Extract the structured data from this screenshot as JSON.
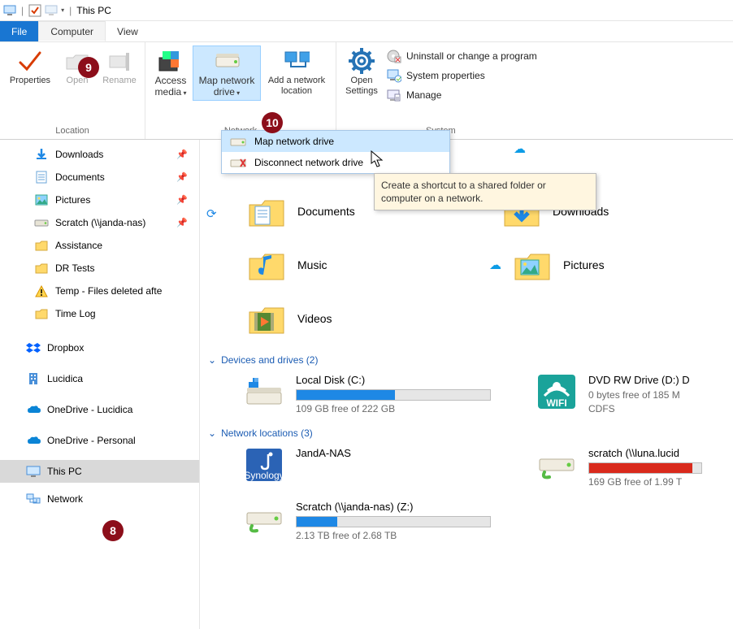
{
  "window": {
    "title": "This PC"
  },
  "tabs": {
    "file": "File",
    "computer": "Computer",
    "view": "View"
  },
  "ribbon": {
    "location_group": "Location",
    "network_group": "Network",
    "system_group": "System",
    "properties": "Properties",
    "open": "Open",
    "rename": "Rename",
    "access_media": "Access media",
    "map_network_drive": "Map network drive",
    "add_network_location": "Add a network location",
    "open_settings": "Open Settings",
    "uninstall": "Uninstall or change a program",
    "system_props": "System properties",
    "manage": "Manage"
  },
  "dropdown": {
    "map": "Map network drive",
    "disconnect": "Disconnect network drive"
  },
  "tooltip": "Create a shortcut to a shared folder or computer on a network.",
  "nav": {
    "items": [
      {
        "label": "Downloads",
        "icon": "download",
        "pinned": true
      },
      {
        "label": "Documents",
        "icon": "doc",
        "pinned": true
      },
      {
        "label": "Pictures",
        "icon": "pic",
        "pinned": true
      },
      {
        "label": "Scratch (\\\\janda-nas)",
        "icon": "netdrive",
        "pinned": true
      },
      {
        "label": "Assistance",
        "icon": "folder",
        "pinned": false
      },
      {
        "label": "DR Tests",
        "icon": "folder",
        "pinned": false
      },
      {
        "label": "Temp - Files deleted afte",
        "icon": "warn",
        "pinned": false
      },
      {
        "label": "Time Log",
        "icon": "folder",
        "pinned": false
      }
    ],
    "roots": [
      {
        "label": "Dropbox",
        "icon": "dropbox"
      },
      {
        "label": "Lucidica",
        "icon": "building"
      },
      {
        "label": "OneDrive - Lucidica",
        "icon": "onedrive"
      },
      {
        "label": "OneDrive - Personal",
        "icon": "onedrive"
      },
      {
        "label": "This PC",
        "icon": "pc",
        "selected": true
      },
      {
        "label": "Network",
        "icon": "network"
      }
    ]
  },
  "folders": {
    "row1": {
      "left": "Documents",
      "right": "Downloads"
    },
    "row2": {
      "left": "Music",
      "right": "Pictures"
    },
    "row3": {
      "left": "Videos"
    }
  },
  "sections": {
    "devices_label": "Devices and drives (2)",
    "network_label": "Network locations (3)"
  },
  "drives": {
    "local": {
      "name": "Local Disk (C:)",
      "sub": "109 GB free of 222 GB",
      "fill": 51
    },
    "dvd": {
      "name": "DVD RW Drive (D:) D",
      "sub": "0 bytes free of 185 M",
      "sub2": "CDFS"
    },
    "janda": {
      "name": "JandA-NAS"
    },
    "scratch_remote": {
      "name": "scratch (\\\\luna.lucid",
      "sub": "169 GB free of 1.99 T",
      "fill": 92
    },
    "scratch_z": {
      "name": "Scratch (\\\\janda-nas) (Z:)",
      "sub": "2.13 TB free of 2.68 TB",
      "fill": 21
    }
  },
  "badges": {
    "b8": "8",
    "b9": "9",
    "b10": "10"
  }
}
